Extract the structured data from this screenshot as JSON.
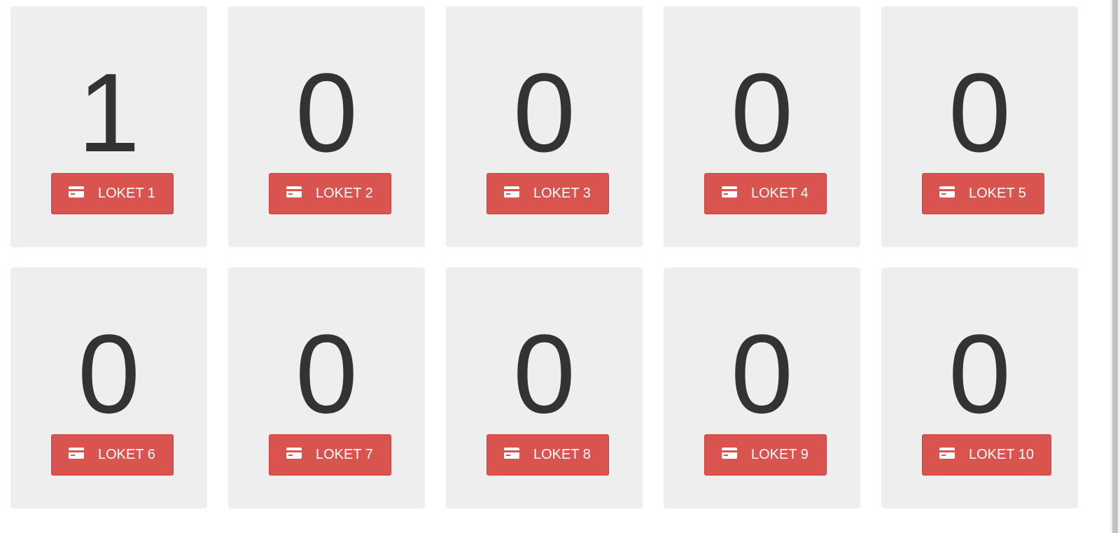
{
  "counters": [
    {
      "count": "1",
      "button_label": "LOKET 1",
      "icon": "credit-card-icon"
    },
    {
      "count": "0",
      "button_label": "LOKET 2",
      "icon": "credit-card-icon"
    },
    {
      "count": "0",
      "button_label": "LOKET 3",
      "icon": "credit-card-icon"
    },
    {
      "count": "0",
      "button_label": "LOKET 4",
      "icon": "credit-card-icon"
    },
    {
      "count": "0",
      "button_label": "LOKET 5",
      "icon": "credit-card-icon"
    },
    {
      "count": "0",
      "button_label": "LOKET 6",
      "icon": "credit-card-icon"
    },
    {
      "count": "0",
      "button_label": "LOKET 7",
      "icon": "credit-card-icon"
    },
    {
      "count": "0",
      "button_label": "LOKET 8",
      "icon": "credit-card-icon"
    },
    {
      "count": "0",
      "button_label": "LOKET 9",
      "icon": "credit-card-icon"
    },
    {
      "count": "0",
      "button_label": "LOKET 10",
      "icon": "credit-card-icon"
    }
  ],
  "colors": {
    "card_background": "#eeeeee",
    "button_background": "#d9534f",
    "count_text": "#333333"
  }
}
